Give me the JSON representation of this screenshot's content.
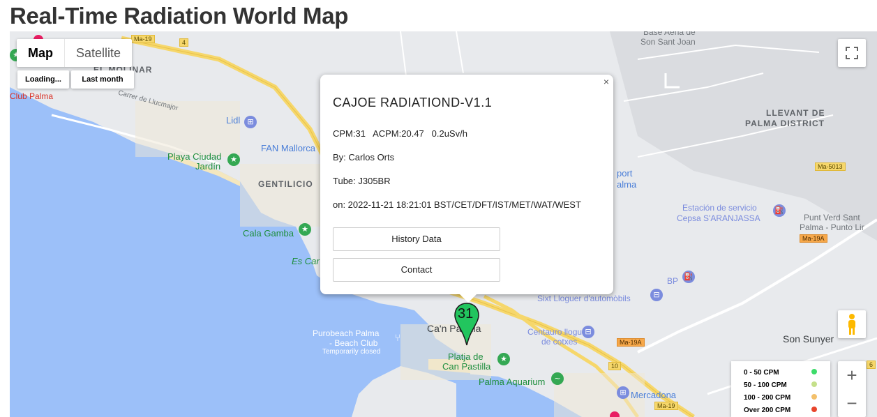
{
  "page": {
    "title": "Real-Time Radiation World Map"
  },
  "map_controls": {
    "map_type": [
      "Map",
      "Satellite"
    ],
    "active_type": "Map",
    "range_buttons": [
      "Loading...",
      "Last month"
    ],
    "fullscreen_icon": "fullscreen-icon",
    "pegman_icon": "street-view-pegman-icon",
    "zoom_in": "+",
    "zoom_out": "−"
  },
  "popup": {
    "title": "CAJOE RADIATIOND-V1.1",
    "readings": "CPM:31   ACPM:20.47   0.2uSv/h",
    "by": "By: Carlos Orts",
    "tube": "Tube: J305BR",
    "timestamp": "on: 2022-11-21 18:21:01 BST/CET/DFT/IST/MET/WAT/WEST",
    "history_button": "History Data",
    "contact_button": "Contact",
    "close_icon": "×"
  },
  "marker": {
    "value": "31",
    "color": "#22c55e"
  },
  "legend": [
    {
      "label": "0 - 50 CPM",
      "color": "#3ddc6a"
    },
    {
      "label": "50 - 100 CPM",
      "color": "#c5e08a"
    },
    {
      "label": "100 - 200 CPM",
      "color": "#f3c06b"
    },
    {
      "label": "Over 200 CPM",
      "color": "#e8452c"
    }
  ],
  "map_labels": {
    "el_molinar": "EL MOLINAR",
    "club_palma": "Club Palma",
    "carrer": "Carrer de Llucmajor",
    "lidl": "Lidl",
    "fan": "FAN Mallorca",
    "playa_ciudad": "Playa Ciudad",
    "jardin": "Jardín",
    "gentilicio": "GENTILICIO",
    "cala_gamba": "Cala Gamba",
    "es_car": "Es Car",
    "base_aerea": "Base Aèria de",
    "son_sant_joan": "Son Sant Joan",
    "llevant1": "LLEVANT DE",
    "llevant2": "PALMA DISTRICT",
    "airport1": "port",
    "airport2": "alma",
    "estacion1": "Estación de servicio",
    "estacion2": "Cepsa S'ARANJASSA",
    "punt1": "Punt Verd Sant",
    "punt2": "Palma - Punto Lir",
    "bp": "BP",
    "sixt": "Sixt Lloguer d'automòbils",
    "can_pastilla": "Ca'n Pastilla",
    "centauro1": "Centauro lloguer",
    "centauro2": "de cotxes",
    "son_sunyer": "Son Sunyer",
    "purobeach1": "Purobeach Palma",
    "purobeach2": "- Beach Club",
    "purobeach3": "Temporarily closed",
    "platja1": "Platja de",
    "platja2": "Can Pastilla",
    "aquarium": "Palma Aquarium",
    "mercadona": "Mercadona",
    "ma19_a": "Ma-19",
    "ma19_b": "Ma-19",
    "ma19_c": "Ma-19",
    "ma19a_a": "Ma-19A",
    "ma19a_b": "Ma-19A",
    "ma5013": "Ma-5013",
    "r4": "4",
    "r10": "10",
    "r6": "6"
  }
}
